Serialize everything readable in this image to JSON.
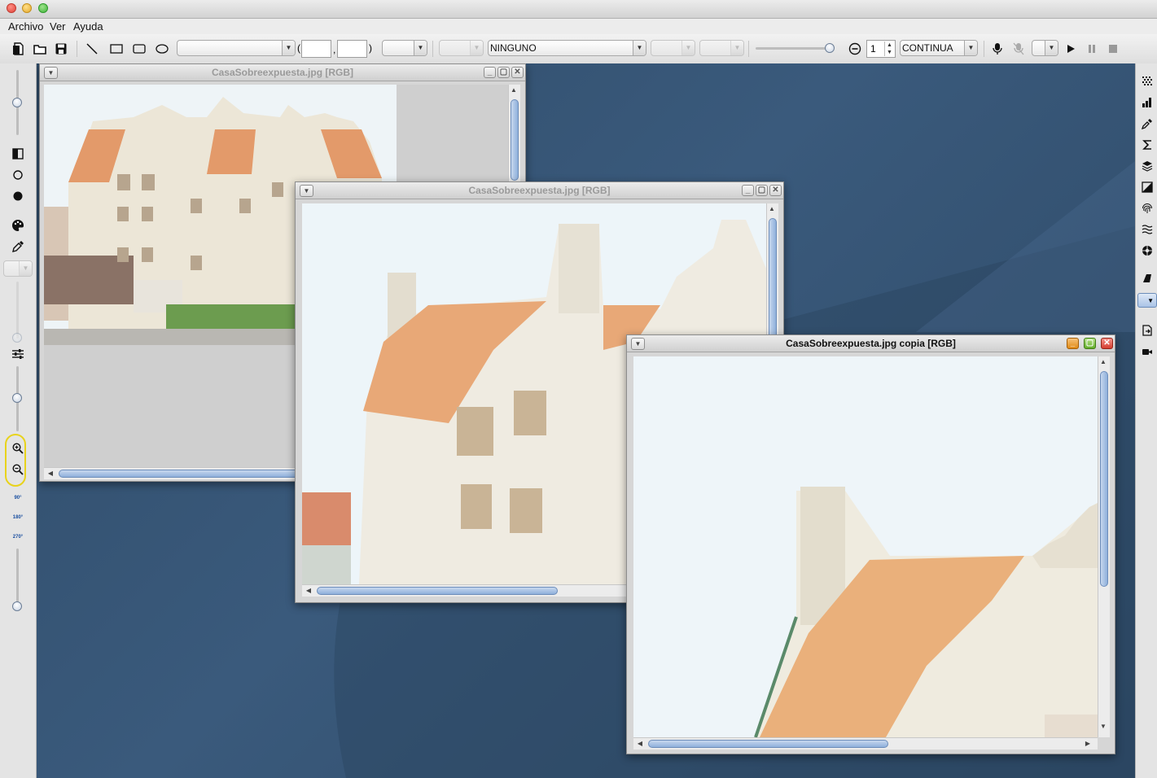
{
  "menu": {
    "items": [
      "Archivo",
      "Ver",
      "Ayuda"
    ]
  },
  "toolbar": {
    "paren_open": "(",
    "comma": ",",
    "paren_close": ")",
    "filter_combo": "NINGUNO",
    "spinner_value": "1",
    "mode_combo": "CONTINUA"
  },
  "windows": [
    {
      "title": "CasaSobreexpuesta.jpg [RGB]",
      "active": false
    },
    {
      "title": "CasaSobreexpuesta.jpg [RGB]",
      "active": false
    },
    {
      "title": "CasaSobreexpuesta.jpg copia [RGB]",
      "active": true
    }
  ],
  "leftbar": {
    "rotate_labels": [
      "90°",
      "180°",
      "270°"
    ]
  },
  "colors": {
    "desktop": "#3a5a7c",
    "highlight": "#e8d31c",
    "scroll_thumb": "#8fb0db"
  }
}
